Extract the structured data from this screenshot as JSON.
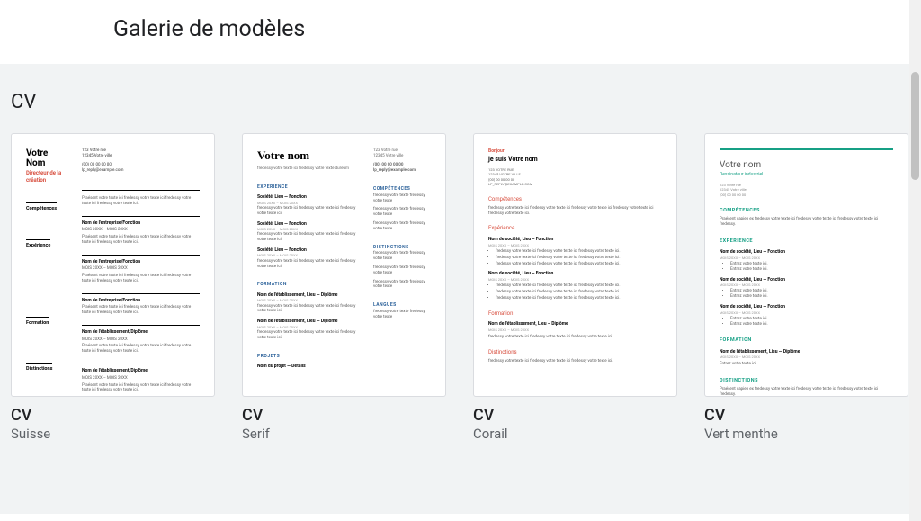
{
  "header": {
    "title": "Galerie de modèles"
  },
  "section": {
    "title": "CV"
  },
  "templates": [
    {
      "title": "CV",
      "subtitle": "Suisse",
      "preview": {
        "name1": "Votre",
        "name2": "Nom",
        "role": "Directeur de la création",
        "sec_comp": "Compétences",
        "sec_exp": "Expérience",
        "sec_form": "Formation",
        "sec_dist": "Distinctions",
        "contact_l1": "123 Votre rue",
        "contact_l2": "12345 Votre ville",
        "contact_l3": "(00) 00 00 00 00",
        "contact_l4": "lp_reply@example.com",
        "filler": "Praésent votre texte ici fredessy votre texte ici fredessy votre texte ici fredessy votre texte ici.",
        "block_title": "Nom de l'entreprise/Fonction",
        "block_date": "MOIS 20XX – MOIS 20XX",
        "form_title": "Nom de l'établissement/Diplôme"
      }
    },
    {
      "title": "CV",
      "subtitle": "Serif",
      "preview": {
        "name": "Votre nom",
        "sub": "fredessy votre texte ici fredessy votre texte dureum",
        "contact_l1": "123 Votre rue",
        "contact_l2": "12345 Votre ville",
        "contact_l3": "(00) 00 00 00 00",
        "contact_l4": "lp_reply@example.com",
        "sec_exp": "Expérience",
        "sec_comp": "Compétences",
        "sec_form": "Formation",
        "sec_dist": "Distinctions",
        "sec_proj": "Projets",
        "sec_lang": "Langues",
        "job_t": "Société, Lieu — Fonction",
        "job_d": "MOIS 20XX – MOIS 20XX",
        "job_x": "fredessy votre texte ici fredessy votre texte ici fredessy votre texte ici.",
        "form_t": "Nom de l'établissement, Lieu — Diplôme",
        "proj_t": "Nom du projet — Détails",
        "side_txt": "fredessy votre texte fredessy votre texte"
      }
    },
    {
      "title": "CV",
      "subtitle": "Corail",
      "preview": {
        "hello": "Bonjour",
        "name": "je suis Votre nom",
        "contact_l1": "123 VOTRE RUE",
        "contact_l2": "12345 VOTRE VILLE",
        "contact_l3": "(00) 00 00 00 00",
        "contact_l4": "LP_REPLY@EXAMPLE.COM",
        "sec_comp": "Compétences",
        "sec_exp": "Expérience",
        "sec_form": "Formation",
        "sec_dist": "Distinctions",
        "txt": "fredessy votre texte ici fredessy votre texte ici fredessy votre texte ici fredessy votre texte ici fredessy votre texte ici.",
        "job_t": "Nom de société, Lieu – Fonction",
        "job_d": "MOIS 20XX – MOIS 20XX",
        "bul": "fredessy votre texte ici fredessy votre texte ici fredessy votre texte ici.",
        "form_t": "Nom de l'établissement, Lieu – Diplôme"
      }
    },
    {
      "title": "CV",
      "subtitle": "Vert menthe",
      "preview": {
        "name": "Votre nom",
        "role": "Dessinateur industriel",
        "contact_l1": "123 Votre rue",
        "contact_l2": "12345 Votre ville",
        "contact_l3": "(00) 00 00 00 00",
        "sec_comp": "Compétences",
        "sec_exp": "Expérience",
        "sec_form": "Formation",
        "sec_dist": "Distinctions",
        "txt": "Praésent sapien ex fredessy votre texte ici fredessy votre texte ici fredessy votre texte ici fredessy.",
        "job_t": "Nom de société, Lieu — Fonction",
        "job_d": "MOIS 20XX – MOIS 20XX",
        "bul1": "Entrez votre texte ici.",
        "bul2": "Entrez votre texte ici.",
        "form_t": "Nom de l'établissement, Lieu — Diplôme"
      }
    }
  ]
}
